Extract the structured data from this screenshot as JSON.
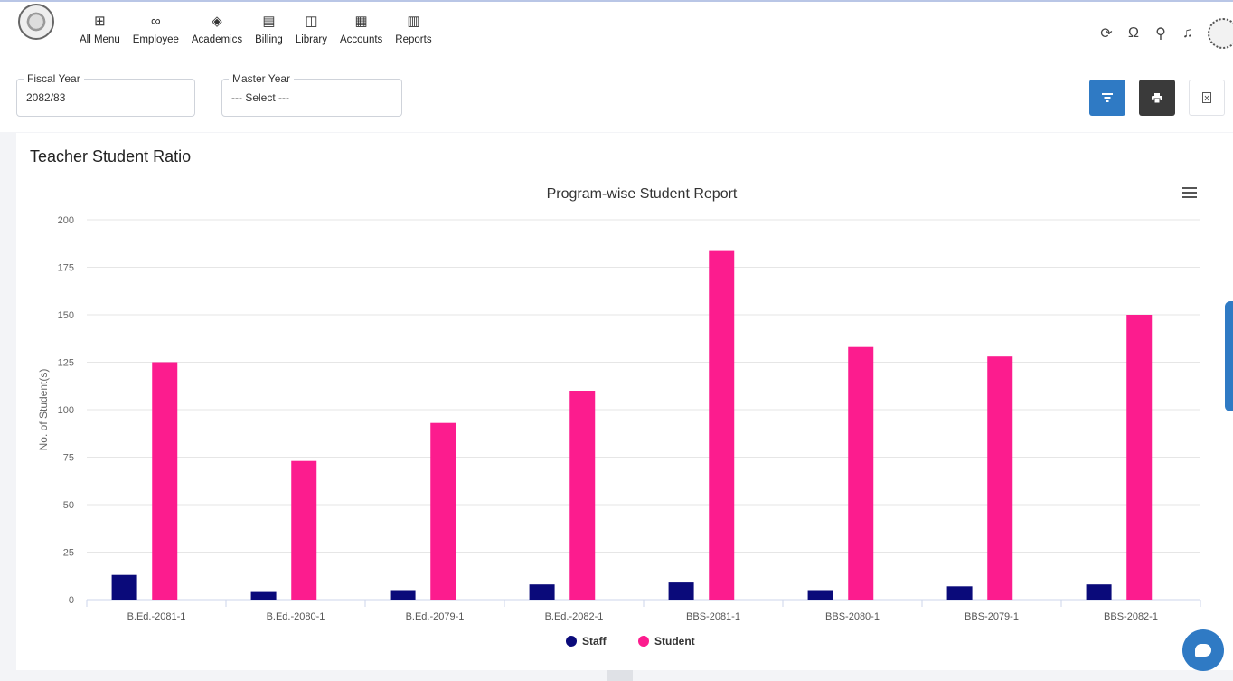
{
  "nav": [
    {
      "label": "All Menu",
      "icon": "grid-icon",
      "glyph": "⊞"
    },
    {
      "label": "Employee",
      "icon": "users-icon",
      "glyph": "∞"
    },
    {
      "label": "Academics",
      "icon": "layers-icon",
      "glyph": "◈"
    },
    {
      "label": "Billing",
      "icon": "document-icon",
      "glyph": "▤"
    },
    {
      "label": "Library",
      "icon": "book-icon",
      "glyph": "◫"
    },
    {
      "label": "Accounts",
      "icon": "calculator-icon",
      "glyph": "▦"
    },
    {
      "label": "Reports",
      "icon": "report-icon",
      "glyph": "▥"
    }
  ],
  "filters": {
    "fiscal_year_label": "Fiscal Year",
    "fiscal_year_value": "2082/83",
    "master_year_label": "Master Year",
    "master_year_value": "--- Select ---"
  },
  "card": {
    "title": "Teacher Student Ratio"
  },
  "colors": {
    "staff": "#0a0a7a",
    "student": "#fc1c8e",
    "accent": "#2f7ac4"
  },
  "chart_data": {
    "type": "bar",
    "title": "Program-wise Student Report",
    "xlabel": "",
    "ylabel": "No. of Student(s)",
    "ylim": [
      0,
      200
    ],
    "yticks": [
      0,
      25,
      50,
      75,
      100,
      125,
      150,
      175,
      200
    ],
    "categories": [
      "B.Ed.-2081-1",
      "B.Ed.-2080-1",
      "B.Ed.-2079-1",
      "B.Ed.-2082-1",
      "BBS-2081-1",
      "BBS-2080-1",
      "BBS-2079-1",
      "BBS-2082-1"
    ],
    "series": [
      {
        "name": "Staff",
        "values": [
          13,
          4,
          5,
          8,
          9,
          5,
          7,
          8
        ]
      },
      {
        "name": "Student",
        "values": [
          125,
          73,
          93,
          110,
          184,
          133,
          128,
          150
        ]
      }
    ],
    "grid": true,
    "legend": "bottom-center"
  }
}
